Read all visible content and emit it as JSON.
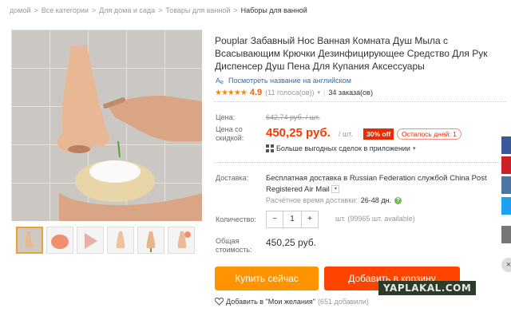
{
  "breadcrumb": {
    "items": [
      "домой",
      "Все категории",
      "Для дома и сада",
      "Товары для ванной",
      "Наборы для ванной"
    ],
    "separator": ">"
  },
  "product": {
    "title": "Pouplar Забавный Нос Ванная Комната Душ Мыла с Всасывающим Крючки Дезинфицирующее Средство Для Рук Диспенсер Душ Пена Для Купания Аксессуары",
    "translate_link": "Посмотреть название на английском",
    "rating": "4.9",
    "votes": "(11 голоса(ов))",
    "orders": "34 заказа(ов)",
    "stars": "★★★★★"
  },
  "price": {
    "label": "Цена:",
    "old": "642,74 руб. / шт.",
    "sale_label_1": "Цена со",
    "sale_label_2": "скидкой:",
    "new": "450,25 руб.",
    "per_unit": "/ шт.",
    "discount": "30% off",
    "days_left": "Осталось дней: 1",
    "app_deals": "Больше выгодных сделок в приложении"
  },
  "shipping": {
    "label": "Доставка:",
    "text": "Бесплатная доставка в Russian Federation службой China Post Registered Air Mail",
    "time_label": "Расчётное время доставки:",
    "time_value": "26-48 дн."
  },
  "quantity": {
    "label": "Количество:",
    "minus": "−",
    "value": "1",
    "plus": "+",
    "available": "шт. (99965 шт. available)"
  },
  "total": {
    "label_1": "Общая",
    "label_2": "стоимость:",
    "value": "450,25 руб."
  },
  "actions": {
    "buy_now": "Купить сейчас",
    "add_to_cart": "Добавить в корзину",
    "wishlist": "Добавить в \"Мои желания\"",
    "wishlist_count": "(651 добавили)"
  },
  "watermark": "YAPLAKAL.COM",
  "colors": {
    "price_red": "#ff3800",
    "buy_orange": "#ff9400",
    "cart_red": "#ff4400",
    "link_blue": "#2a6ebb",
    "star": "#ff8800"
  }
}
